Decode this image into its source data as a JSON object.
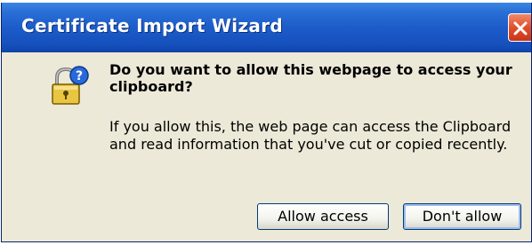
{
  "dialog": {
    "title": "Certificate Import Wizard",
    "close_icon": "close-icon",
    "icon": "security-lock-question-icon",
    "message_title": "Do you want to allow this webpage to access your clipboard?",
    "message_body": "If you allow this, the web page can access the Clipboard and read information that you've cut or copied recently.",
    "buttons": {
      "allow_label": "Allow access",
      "deny_label": "Don't allow"
    },
    "colors": {
      "titlebar": "#1c5cc9",
      "body": "#ece9d8",
      "close": "#e0502c",
      "button_border": "#003c74"
    }
  }
}
